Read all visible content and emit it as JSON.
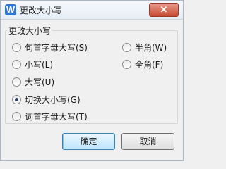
{
  "window": {
    "title": "更改大小写",
    "app_icon_letter": "W",
    "close_label": "✕"
  },
  "group": {
    "label": "更改大小写"
  },
  "options_left": [
    {
      "label": "句首字母大写(S)",
      "checked": false
    },
    {
      "label": "小写(L)",
      "checked": false
    },
    {
      "label": "大写(U)",
      "checked": false
    },
    {
      "label": "切换大小写(G)",
      "checked": true
    },
    {
      "label": "词首字母大写(T)",
      "checked": false
    }
  ],
  "options_right": [
    {
      "label": "半角(W)",
      "checked": false
    },
    {
      "label": "全角(F)",
      "checked": false
    }
  ],
  "buttons": {
    "ok": "确定",
    "cancel": "取消"
  }
}
